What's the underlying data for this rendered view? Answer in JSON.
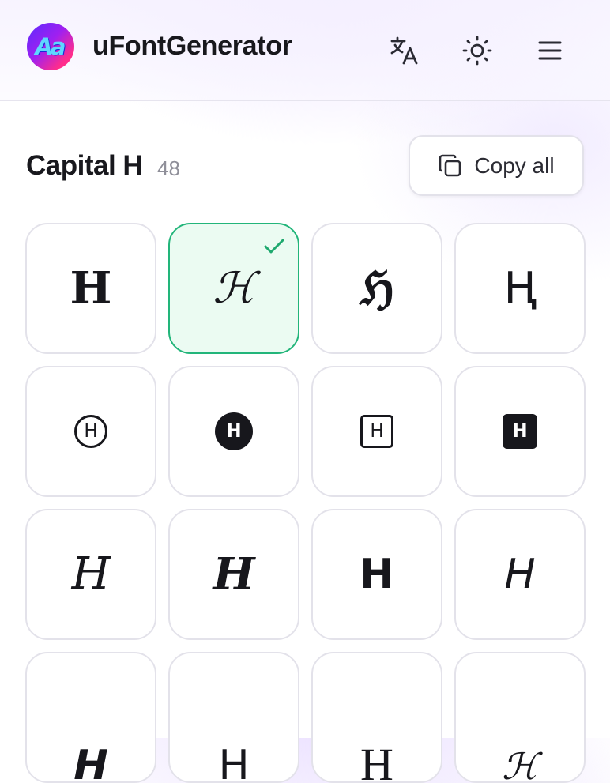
{
  "header": {
    "logo_text": "Aa",
    "title": "uFontGenerator",
    "icons": [
      "translate-icon",
      "sun-icon",
      "menu-icon"
    ]
  },
  "section": {
    "title": "Capital H",
    "count": "48",
    "copy_all_label": "Copy all"
  },
  "colors": {
    "selected_border": "#22b57a",
    "selected_background": "#ebfbf2",
    "check": "#1fa96f",
    "tile_border": "#e3e2ea",
    "text": "#17171c"
  },
  "tiles": [
    {
      "glyph": "𝐇",
      "style": "math-bold-serif",
      "selected": false
    },
    {
      "glyph": "ℋ",
      "style": "script",
      "selected": true
    },
    {
      "glyph": "ℌ",
      "style": "fraktur",
      "selected": false
    },
    {
      "glyph": "Ⱨ",
      "style": "double-struck",
      "selected": false
    },
    {
      "glyph": "H",
      "style": "circled",
      "selected": false
    },
    {
      "glyph": "H",
      "style": "negative-circled",
      "selected": false
    },
    {
      "glyph": "H",
      "style": "squared",
      "selected": false
    },
    {
      "glyph": "H",
      "style": "negative-squared",
      "selected": false
    },
    {
      "glyph": "𝐻",
      "style": "math-italic-serif",
      "selected": false
    },
    {
      "glyph": "𝑯",
      "style": "math-bold-italic-serif",
      "selected": false
    },
    {
      "glyph": "𝗛",
      "style": "math-bold-sans",
      "selected": false
    },
    {
      "glyph": "𝘏",
      "style": "math-italic-sans",
      "selected": false
    },
    {
      "glyph": "𝙃",
      "style": "math-bold-italic-sans",
      "selected": false
    },
    {
      "glyph": "𝖧",
      "style": "math-sans",
      "selected": false
    },
    {
      "glyph": "H",
      "style": "serif",
      "selected": false
    },
    {
      "glyph": "ℋ",
      "style": "script-small",
      "selected": false
    }
  ]
}
